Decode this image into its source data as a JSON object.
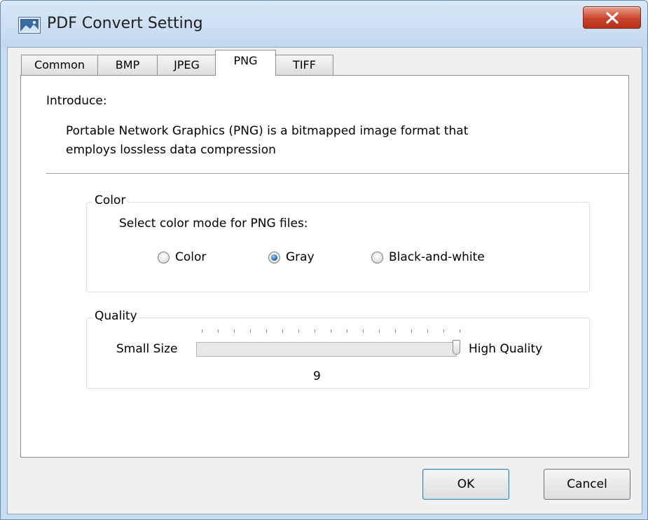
{
  "window": {
    "title": "PDF Convert Setting",
    "close_label": "X"
  },
  "tabs": [
    {
      "label": "Common",
      "active": false
    },
    {
      "label": "BMP",
      "active": false
    },
    {
      "label": "JPEG",
      "active": false
    },
    {
      "label": "PNG",
      "active": true
    },
    {
      "label": "TIFF",
      "active": false
    }
  ],
  "introduce": {
    "label": "Introduce:",
    "description_line1": "Portable Network Graphics (PNG) is a bitmapped image format that",
    "description_line2": "employs lossless data compression"
  },
  "color_group": {
    "title": "Color",
    "description": "Select color mode for PNG files:",
    "options": [
      {
        "label": "Color",
        "checked": false
      },
      {
        "label": "Gray",
        "checked": true
      },
      {
        "label": "Black-and-white",
        "checked": false
      }
    ]
  },
  "quality_group": {
    "title": "Quality",
    "min_label": "Small Size",
    "max_label": "High Quality",
    "value": "9"
  },
  "buttons": {
    "ok": "OK",
    "cancel": "Cancel"
  }
}
